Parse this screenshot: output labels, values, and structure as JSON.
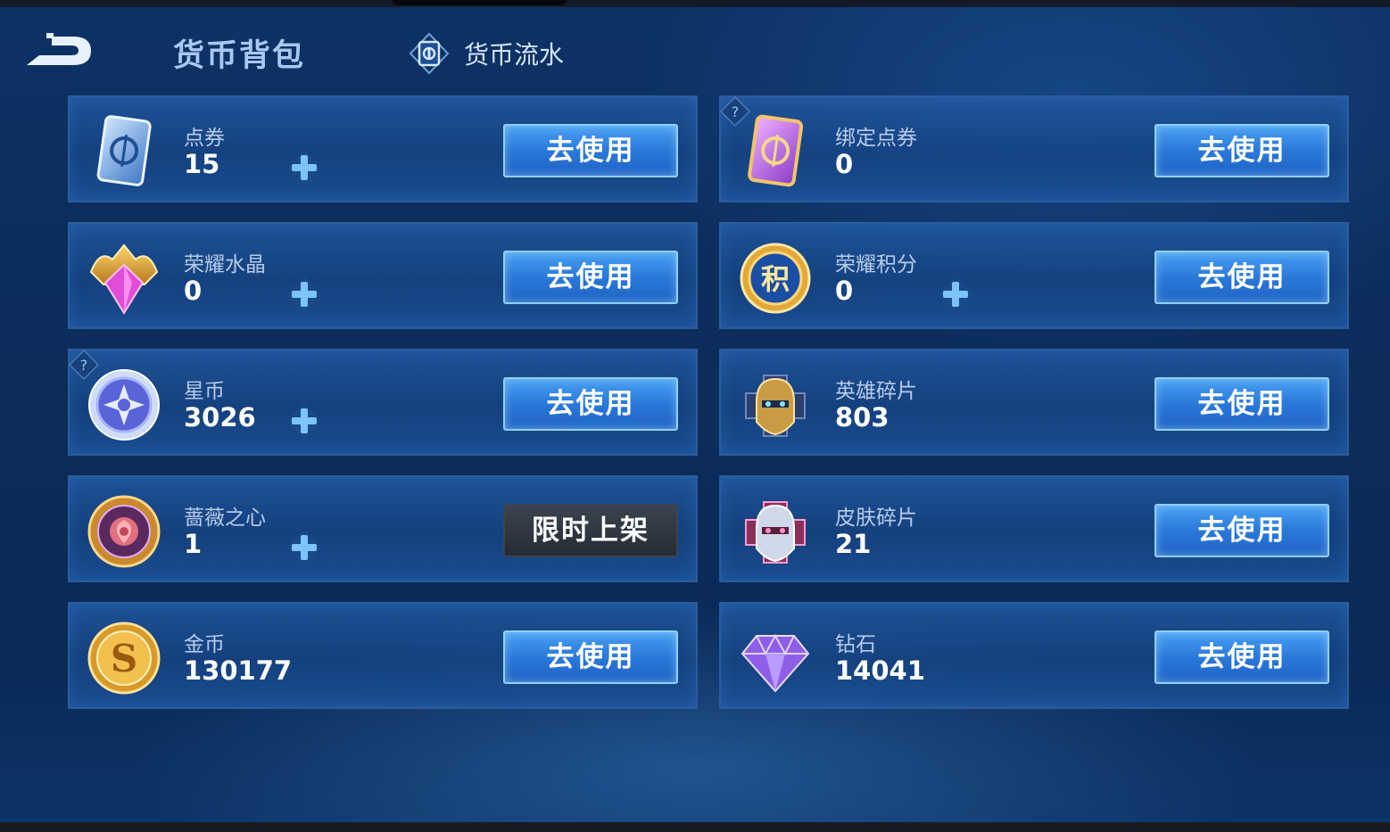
{
  "header": {
    "title": "货币背包",
    "flow_label": "货币流水"
  },
  "currencies": [
    {
      "name": "点券",
      "amount": "15",
      "button": "去使用",
      "icon": "coupon-card-icon",
      "has_plus": true,
      "has_help": false
    },
    {
      "name": "绑定点券",
      "amount": "0",
      "button": "去使用",
      "icon": "bound-coupon-card-icon",
      "has_plus": false,
      "has_help": true
    },
    {
      "name": "荣耀水晶",
      "amount": "0",
      "button": "去使用",
      "icon": "glory-crystal-icon",
      "has_plus": true,
      "has_help": false
    },
    {
      "name": "荣耀积分",
      "amount": "0",
      "button": "去使用",
      "icon": "glory-points-icon",
      "has_plus": true,
      "has_help": false
    },
    {
      "name": "星币",
      "amount": "3026",
      "button": "去使用",
      "icon": "star-coin-icon",
      "has_plus": true,
      "has_help": true
    },
    {
      "name": "英雄碎片",
      "amount": "803",
      "button": "去使用",
      "icon": "hero-fragment-icon",
      "has_plus": false,
      "has_help": false
    },
    {
      "name": "蔷薇之心",
      "amount": "1",
      "button": "限时上架",
      "icon": "rose-heart-icon",
      "has_plus": true,
      "has_help": false
    },
    {
      "name": "皮肤碎片",
      "amount": "21",
      "button": "去使用",
      "icon": "skin-fragment-icon",
      "has_plus": false,
      "has_help": false
    },
    {
      "name": "金币",
      "amount": "130177",
      "button": "去使用",
      "icon": "gold-coin-icon",
      "has_plus": false,
      "has_help": false
    },
    {
      "name": "钻石",
      "amount": "14041",
      "button": "去使用",
      "icon": "diamond-icon",
      "has_plus": false,
      "has_help": false
    }
  ],
  "icon_glyphs": {
    "glory_points": "积",
    "gold_coin": "S"
  },
  "colors": {
    "accent_button": "#2a79da",
    "limited_button": "#262c35",
    "background": "#0c2c5a"
  }
}
